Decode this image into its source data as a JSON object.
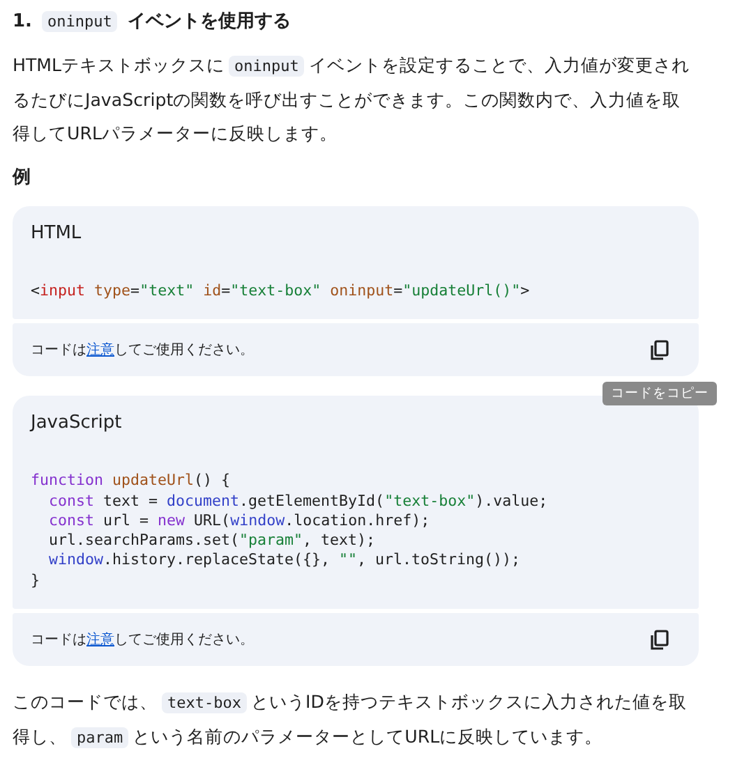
{
  "heading": {
    "number": "1.",
    "code": "oninput",
    "text": "イベントを使用する"
  },
  "intro": [
    {
      "kind": "text",
      "text": "HTMLテキストボックスに"
    },
    {
      "kind": "code",
      "text": "oninput"
    },
    {
      "kind": "text",
      "text": "イベントを設定することで、入力値が変更されるたびにJavaScriptの関数を呼び出すことができます。この関数内で、入力値を取得してURLパラメーターに反映します。"
    }
  ],
  "example_label": "例",
  "code_blocks": [
    {
      "language": "HTML",
      "lines": [
        [
          {
            "kind": "plain",
            "text": "<"
          },
          {
            "kind": "tag",
            "text": "input"
          },
          {
            "kind": "attr",
            "text": " type"
          },
          {
            "kind": "plain",
            "text": "="
          },
          {
            "kind": "string",
            "text": "\"text\""
          },
          {
            "kind": "attr",
            "text": " id"
          },
          {
            "kind": "plain",
            "text": "="
          },
          {
            "kind": "string",
            "text": "\"text-box\""
          },
          {
            "kind": "attr",
            "text": " oninput"
          },
          {
            "kind": "plain",
            "text": "="
          },
          {
            "kind": "string",
            "text": "\"updateUrl()\""
          },
          {
            "kind": "plain",
            "text": ">"
          }
        ]
      ],
      "footer": {
        "before": "コードは",
        "link": "注意",
        "after": "してご使用ください。"
      },
      "tooltip": "コードをコピー"
    },
    {
      "language": "JavaScript",
      "lines": [
        [
          {
            "kind": "keyword",
            "text": "function"
          },
          {
            "kind": "attr",
            "text": " updateUrl"
          },
          {
            "kind": "plain",
            "text": "() {"
          }
        ],
        [
          {
            "kind": "keyword",
            "text": "  const"
          },
          {
            "kind": "plain",
            "text": " text = "
          },
          {
            "kind": "builtin",
            "text": "document"
          },
          {
            "kind": "plain",
            "text": ".getElementById("
          },
          {
            "kind": "string",
            "text": "\"text-box\""
          },
          {
            "kind": "plain",
            "text": ").value;"
          }
        ],
        [
          {
            "kind": "keyword",
            "text": "  const"
          },
          {
            "kind": "plain",
            "text": " url = "
          },
          {
            "kind": "keyword",
            "text": "new"
          },
          {
            "kind": "plain",
            "text": " URL("
          },
          {
            "kind": "builtin",
            "text": "window"
          },
          {
            "kind": "plain",
            "text": ".location.href);"
          }
        ],
        [
          {
            "kind": "plain",
            "text": "  url.searchParams.set("
          },
          {
            "kind": "string",
            "text": "\"param\""
          },
          {
            "kind": "plain",
            "text": ", text);"
          }
        ],
        [
          {
            "kind": "builtin",
            "text": "  window"
          },
          {
            "kind": "plain",
            "text": ".history.replaceState({}, "
          },
          {
            "kind": "string",
            "text": "\"\""
          },
          {
            "kind": "plain",
            "text": ", url.toString());"
          }
        ],
        [
          {
            "kind": "plain",
            "text": "}"
          }
        ]
      ],
      "footer": {
        "before": "コードは",
        "link": "注意",
        "after": "してご使用ください。"
      }
    }
  ],
  "outro": [
    {
      "kind": "text",
      "text": "このコードでは、"
    },
    {
      "kind": "code",
      "text": "text-box"
    },
    {
      "kind": "text",
      "text": "というIDを持つテキストボックスに入力された値を取得し、"
    },
    {
      "kind": "code",
      "text": "param"
    },
    {
      "kind": "text",
      "text": "という名前のパラメーターとしてURLに反映しています。"
    }
  ]
}
